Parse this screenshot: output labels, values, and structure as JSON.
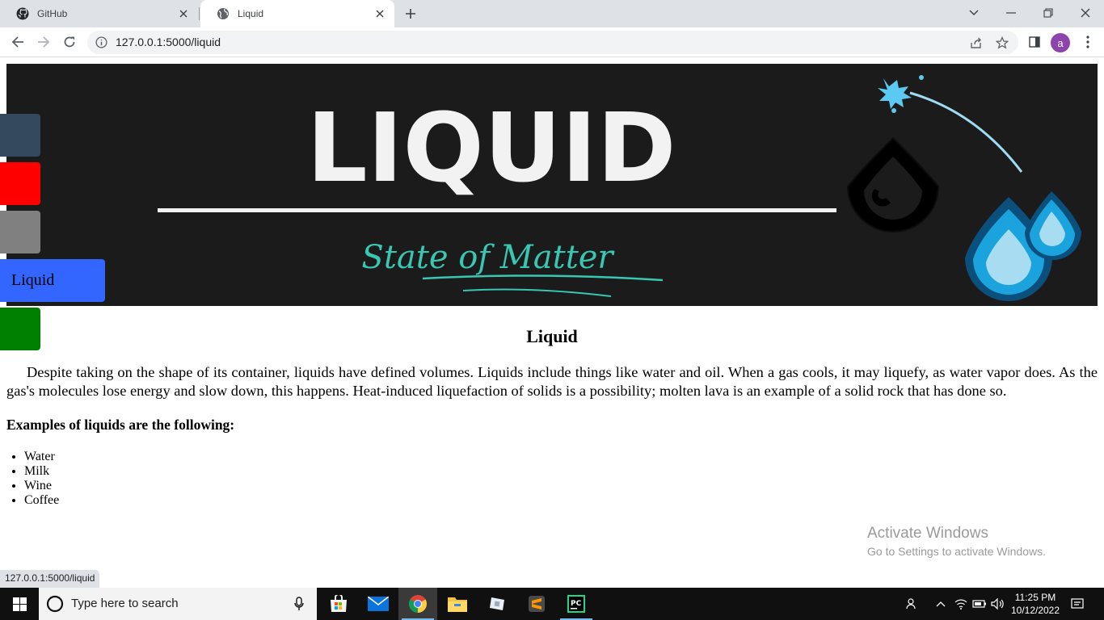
{
  "browser": {
    "tabs": [
      {
        "title": "GitHub",
        "active": false,
        "icon": "github-icon"
      },
      {
        "title": "Liquid",
        "active": true,
        "icon": "globe-icon"
      }
    ],
    "url": "127.0.0.1:5000/liquid",
    "profile_initial": "a",
    "status_url": "127.0.0.1:5000/liquid"
  },
  "banner": {
    "title": "LIQUID",
    "subtitle": "State of Matter"
  },
  "side_nav": {
    "items": [
      {
        "label": "",
        "color": "#34495e"
      },
      {
        "label": "",
        "color": "#ff0000"
      },
      {
        "label": "",
        "color": "#808080"
      },
      {
        "label": "Liquid",
        "color": "#3366ff",
        "active": true
      },
      {
        "label": "",
        "color": "#008000"
      }
    ]
  },
  "content": {
    "heading": "Liquid",
    "paragraph": "Despite taking on the shape of its container, liquids have defined volumes. Liquids include things like water and oil. When a gas cools, it may liquefy, as water vapor does. As the gas's molecules lose energy and slow down, this happens. Heat-induced liquefaction of solids is a possibility; molten lava is an example of a solid rock that has done so.",
    "examples_heading": "Examples of liquids are the following:",
    "examples": [
      "Water",
      "Milk",
      "Wine",
      "Coffee"
    ]
  },
  "watermark": {
    "line1": "Activate Windows",
    "line2": "Go to Settings to activate Windows."
  },
  "taskbar": {
    "search_placeholder": "Type here to search",
    "time": "11:25 PM",
    "date": "10/12/2022",
    "apps": [
      "microsoft-store-icon",
      "mail-icon",
      "chrome-icon",
      "file-explorer-icon",
      "app-icon",
      "sublime-text-icon",
      "pycharm-icon"
    ]
  }
}
